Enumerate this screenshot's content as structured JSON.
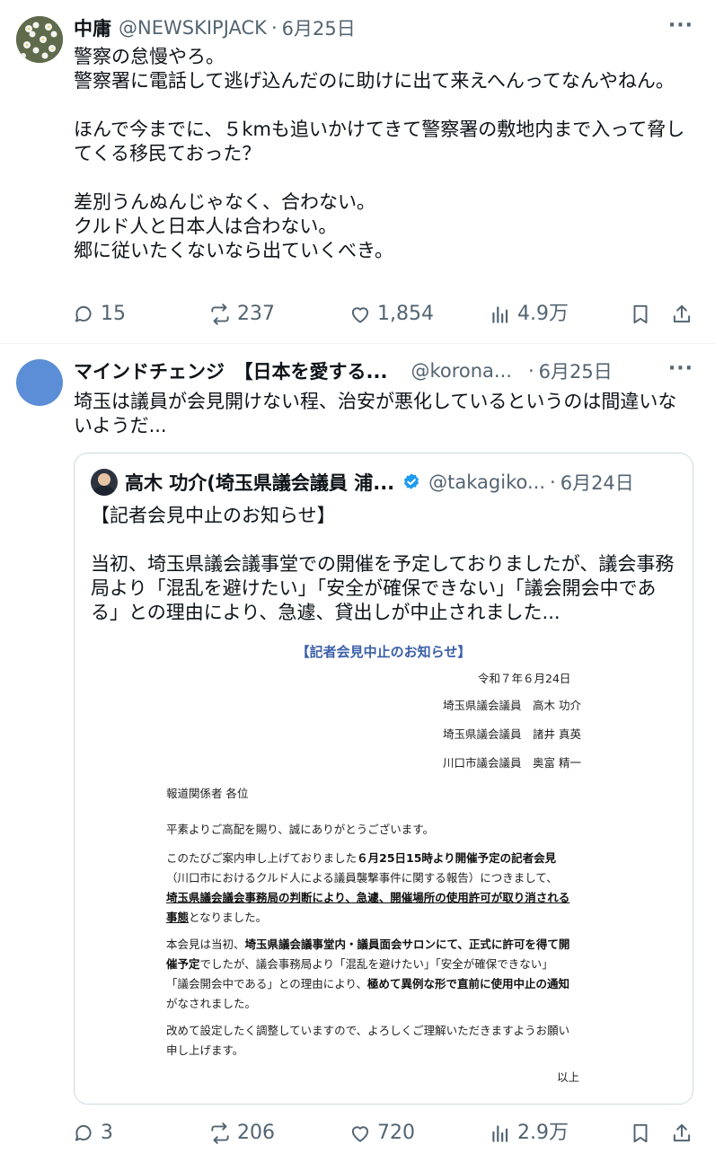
{
  "tweet1": {
    "name": "中庸",
    "handle": "@NEWSKIPJACK",
    "dot": "·",
    "date": "6月25日",
    "more": "···",
    "text": "警察の怠慢やろ。\n警察署に電話して逃げ込んだのに助けに出て来えへんってなんやねん。\n\nほんで今までに、５kmも追いかけてきて警察署の敷地内まで入って脅してくる移民ておった？\n\n差別うんぬんじゃなく、合わない。\nクルド人と日本人は合わない。\n郷に従いたくないなら出ていくべき。",
    "replies": "15",
    "reposts": "237",
    "likes": "1,854",
    "views": "4.9万"
  },
  "tweet2": {
    "name": "マインドチェンジ　【日本を愛する...",
    "handle": "@korona...",
    "dot": "·",
    "date": "6月25日",
    "more": "···",
    "text": "埼玉は議員が会見開けない程、治安が悪化しているというのは間違いないようだ...",
    "replies": "3",
    "reposts": "206",
    "likes": "720",
    "views": "2.9万"
  },
  "quote": {
    "name": "高木 功介(埼玉県議会議員 浦...",
    "handle": "@takagiko...",
    "dot": "·",
    "date": "6月24日",
    "text": "【記者会見中止のお知らせ】\n\n当初、埼玉県議会議事堂での開催を予定しておりましたが、議会事務局より「混乱を避けたい」「安全が確保できない」「議会開会中である」との理由により、急遽、貸出しが中止されました..."
  },
  "document": {
    "title": "【記者会見中止のお知らせ】",
    "date": "令和７年６月24日",
    "member1": "埼玉県議会議員　高木 功介",
    "member2": "埼玉県議会議員　諸井 真英",
    "member3": "川口市議会議員　奥富 精一",
    "addressee": "報道関係者 各位",
    "greeting": "平素よりご高配を賜り、誠にありがとうございます。",
    "p1_l1a": "このたびご案内申し上げておりました",
    "p1_l1b": "６月25日15時より開催予定の記者会見",
    "p1_l2": "（川口市におけるクルド人による議員襲撃事件に関する報告）につきまして、",
    "p1_l3": "埼玉県議会議会事務局の判断により、急遽、開催場所の使用許可が取り消される",
    "p1_l4a": "事態",
    "p1_l4b": "となりました。",
    "p2_l1a": "本会見は当初、",
    "p2_l1b": "埼玉県議会議事堂内・議員面会サロンにて、正式に許可を得て開",
    "p2_l2a": "催予定",
    "p2_l2b": "でしたが、議会事務局より「混乱を避けたい」「安全が確保できない」",
    "p2_l3a": "「議会開会中である」との理由により、",
    "p2_l3b": "極めて異例な形で直前に使用中止の通知",
    "p2_l4": "がなされました。",
    "p3_l1": "改めて設定したく調整していますので、よろしくご理解いただきますようお願い",
    "p3_l2": "申し上げます。",
    "closing": "以上"
  },
  "icons": {
    "reply": "reply-icon",
    "repost": "repost-icon",
    "like": "heart-icon",
    "views": "analytics-icon",
    "bookmark": "bookmark-icon",
    "share": "share-icon",
    "more": "more-icon",
    "verified": "verified-badge-icon"
  },
  "colors": {
    "text": "#0f1419",
    "secondary": "#536471",
    "verified": "#1d9bf0",
    "doc_title": "#3a5fa8"
  }
}
